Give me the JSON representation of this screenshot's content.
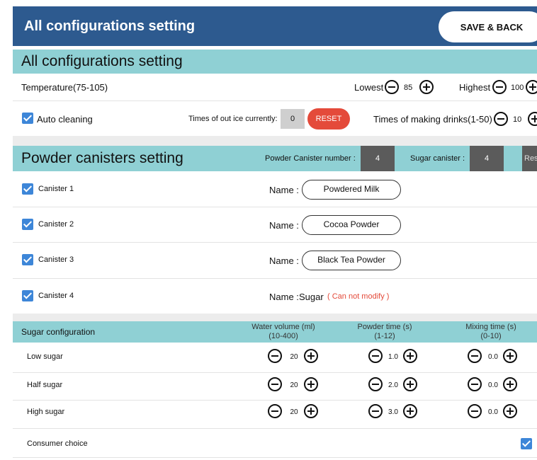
{
  "header": {
    "title": "All configurations setting",
    "save_label": "SAVE & BACK"
  },
  "section1": {
    "title": "All configurations setting"
  },
  "temperature": {
    "label": "Temperature(75-105)",
    "lowest_label": "Lowest",
    "lowest_value": "85",
    "highest_label": "Highest",
    "highest_value": "100"
  },
  "cleaning": {
    "label": "Auto cleaning",
    "times_ice_label": "Times of out ice currently:",
    "times_ice_value": "0",
    "reset_label": "RESET",
    "times_drinks_label": "Times of making drinks(1-50)",
    "times_drinks_value": "10"
  },
  "powder": {
    "title": "Powder canisters setting",
    "canister_number_label": "Powder Canister number :",
    "canister_number_value": "4",
    "sugar_canister_label": "Sugar canister :",
    "sugar_canister_value": "4",
    "reset_partial": "Res"
  },
  "canisters": [
    {
      "label": "Canister 1",
      "name_label": "Name :",
      "name": "Powdered Milk"
    },
    {
      "label": "Canister 2",
      "name_label": "Name :",
      "name": "Cocoa Powder"
    },
    {
      "label": "Canister 3",
      "name_label": "Name :",
      "name": "Black Tea Powder"
    },
    {
      "label": "Canister 4",
      "name_label": "Name :",
      "name": "Sugar",
      "note": "( Can not modify )"
    }
  ],
  "sugar_config": {
    "title": "Sugar configuration",
    "col_water": "Water volume (ml)",
    "col_water_range": "(10-400)",
    "col_powder": "Powder time (s)",
    "col_powder_range": "(1-12)",
    "col_mixing": "Mixing time (s)",
    "col_mixing_range": "(0-10)",
    "rows": [
      {
        "label": "Low sugar",
        "water": "20",
        "powder": "1.0",
        "mixing": "0.0"
      },
      {
        "label": "Half sugar",
        "water": "20",
        "powder": "2.0",
        "mixing": "0.0"
      },
      {
        "label": "High sugar",
        "water": "20",
        "powder": "3.0",
        "mixing": "0.0"
      }
    ],
    "consumer_choice": "Consumer choice"
  },
  "colors": {
    "header_bg": "#2d5a8f",
    "section_bg": "#8fd0d4",
    "accent_red": "#e44a3a",
    "checkbox": "#3d86d8"
  }
}
